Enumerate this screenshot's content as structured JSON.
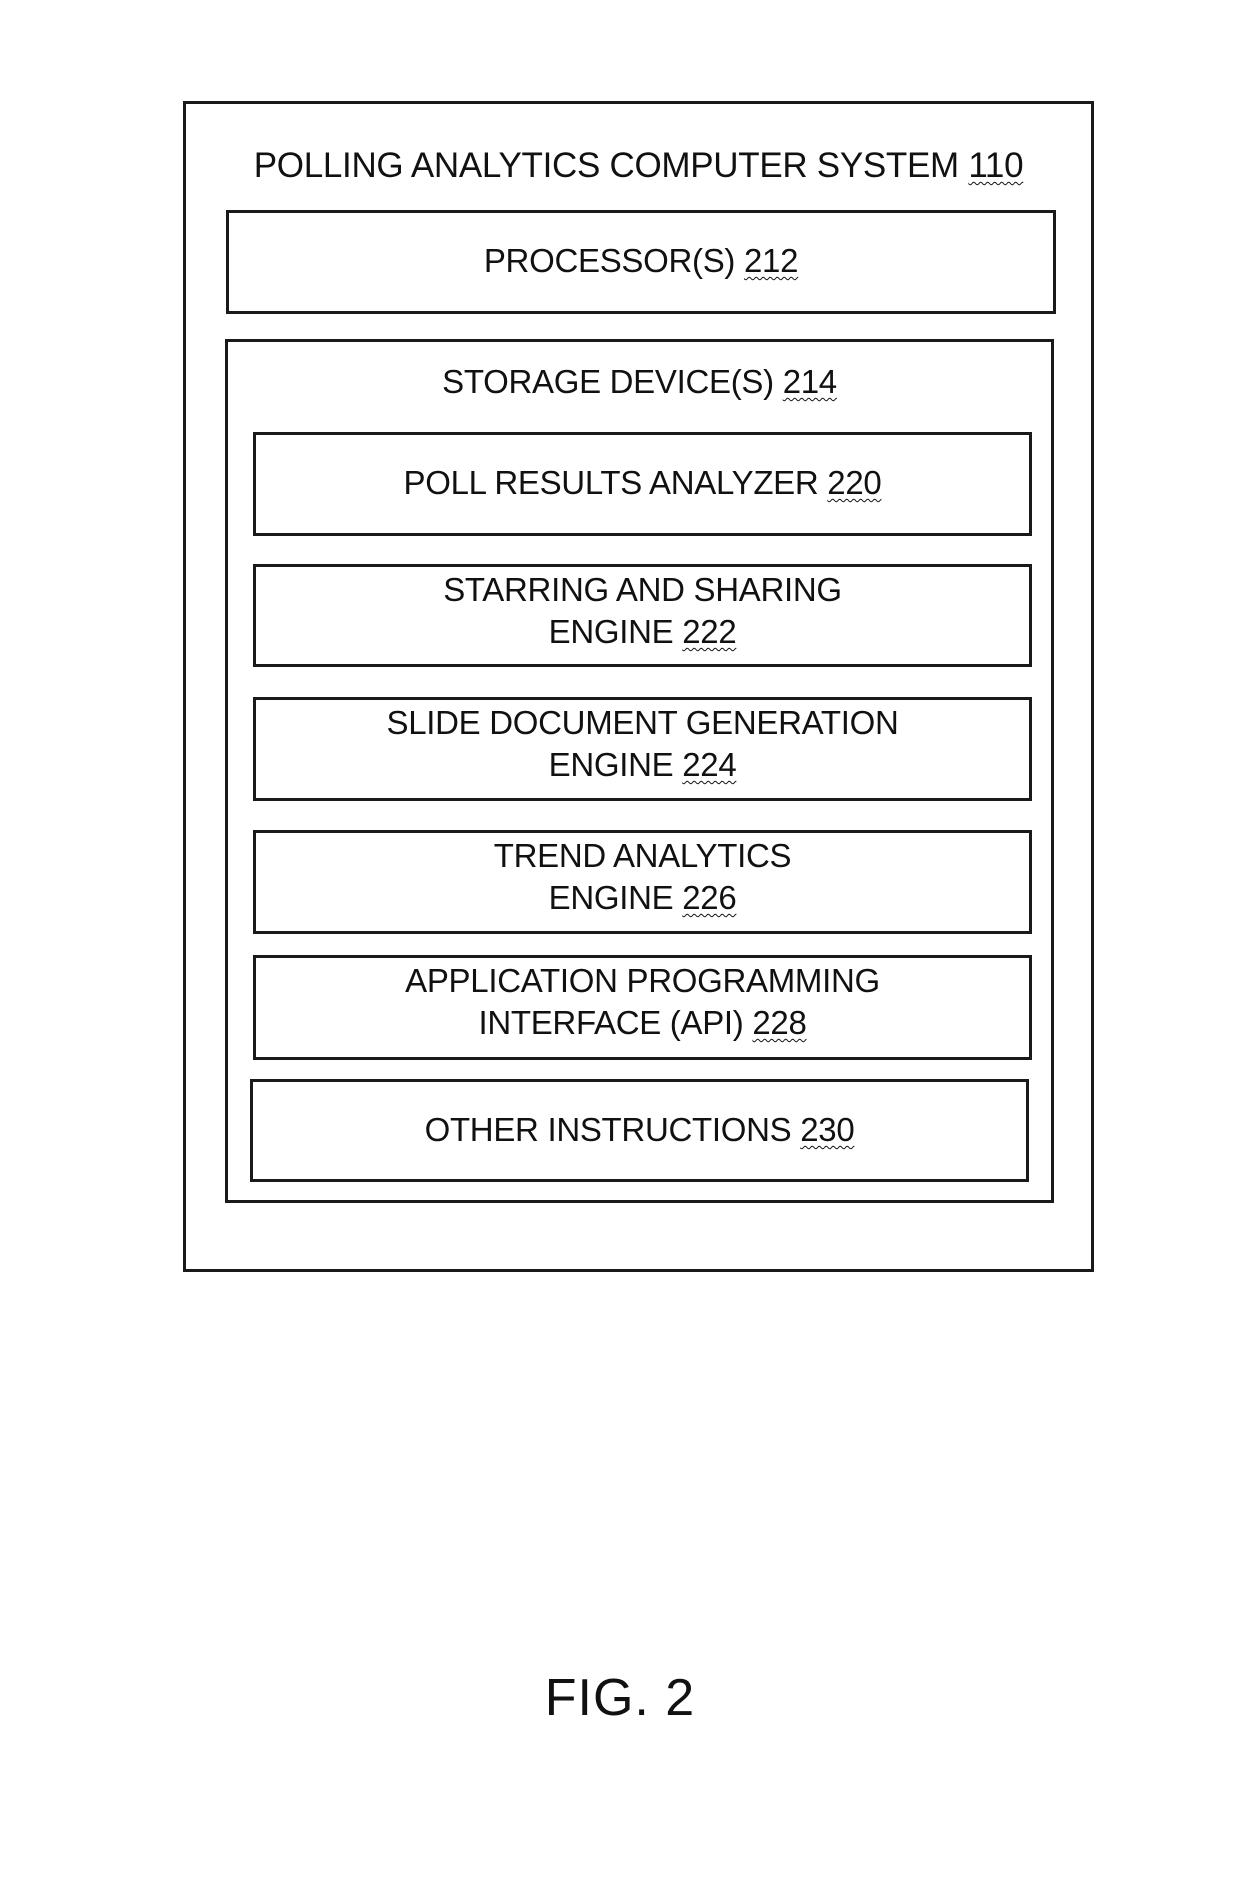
{
  "diagram": {
    "system": {
      "title": "POLLING ANALYTICS COMPUTER SYSTEM",
      "ref": "110"
    },
    "processor": {
      "title": "PROCESSOR(S)",
      "ref": "212"
    },
    "storage": {
      "title": "STORAGE DEVICE(S)",
      "ref": "214",
      "modules": [
        {
          "line1": "POLL RESULTS ANALYZER",
          "line2": "",
          "ref": "220"
        },
        {
          "line1": "STARRING AND SHARING",
          "line2": "ENGINE",
          "ref": "222"
        },
        {
          "line1": "SLIDE DOCUMENT GENERATION",
          "line2": "ENGINE",
          "ref": "224"
        },
        {
          "line1": "TREND ANALYTICS",
          "line2": "ENGINE",
          "ref": "226"
        },
        {
          "line1": "APPLICATION PROGRAMMING",
          "line2": "INTERFACE (API)",
          "ref": "228"
        },
        {
          "line1": "OTHER INSTRUCTIONS",
          "line2": "",
          "ref": "230"
        }
      ]
    },
    "figure_label": "FIG. 2"
  }
}
